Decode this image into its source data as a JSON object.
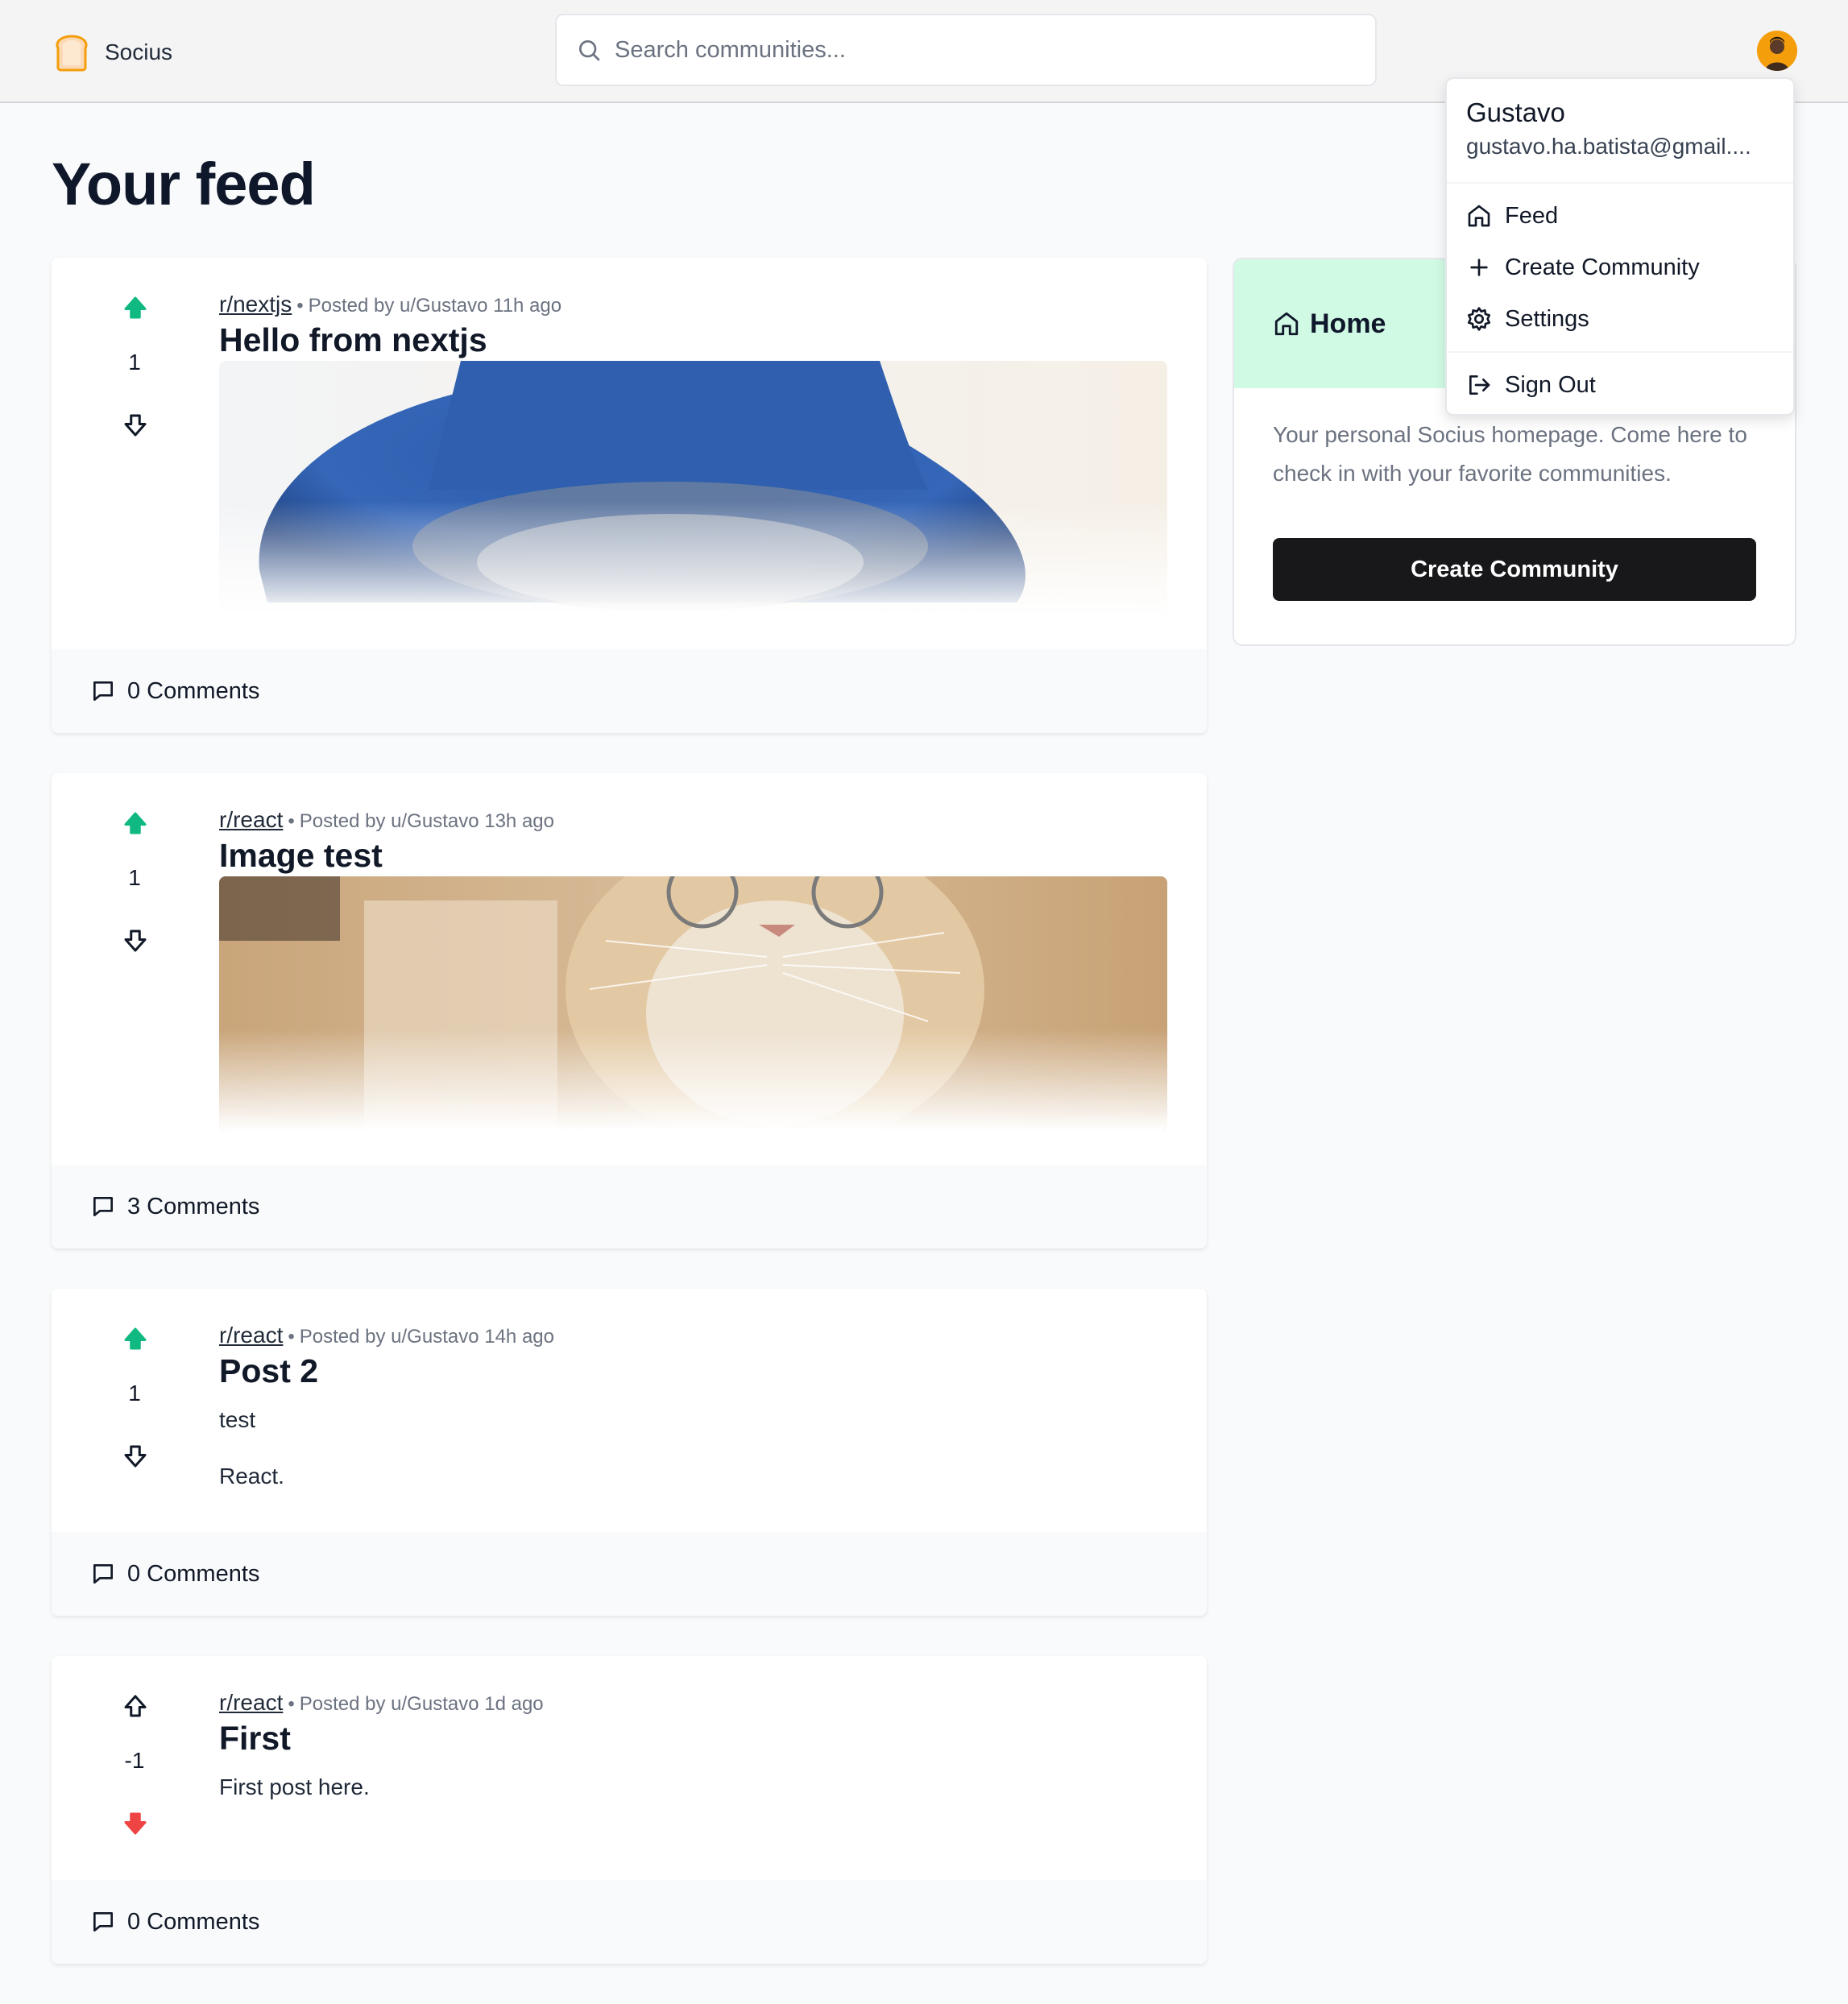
{
  "header": {
    "app_name": "Socius",
    "search_placeholder": "Search communities..."
  },
  "page_title": "Your feed",
  "posts": [
    {
      "subreddit": "r/nextjs",
      "meta": "Posted by u/Gustavo 11h ago",
      "title": "Hello from nextjs",
      "score": "1",
      "vote_state": "up",
      "has_image": true,
      "body": [],
      "comments": "0 Comments"
    },
    {
      "subreddit": "r/react",
      "meta": "Posted by u/Gustavo 13h ago",
      "title": "Image test",
      "score": "1",
      "vote_state": "up",
      "has_image": true,
      "body": [],
      "comments": "3 Comments"
    },
    {
      "subreddit": "r/react",
      "meta": "Posted by u/Gustavo 14h ago",
      "title": "Post 2",
      "score": "1",
      "vote_state": "up",
      "has_image": false,
      "body": [
        "test",
        "React."
      ],
      "comments": "0 Comments"
    },
    {
      "subreddit": "r/react",
      "meta": "Posted by u/Gustavo 1d ago",
      "title": "First",
      "score": "-1",
      "vote_state": "down",
      "has_image": false,
      "body": [
        "First post here."
      ],
      "comments": "0 Comments"
    }
  ],
  "sidebar": {
    "title": "Home",
    "description": "Your personal Socius homepage. Come here to check in with your favorite communities.",
    "button_label": "Create Community"
  },
  "user_menu": {
    "name": "Gustavo",
    "email": "gustavo.ha.batista@gmail....",
    "items": [
      {
        "label": "Feed",
        "icon": "home-icon"
      },
      {
        "label": "Create Community",
        "icon": "plus-icon"
      },
      {
        "label": "Settings",
        "icon": "gear-icon"
      },
      {
        "label": "Sign Out",
        "icon": "sign-out-icon"
      }
    ]
  },
  "colors": {
    "upvote_active": "#10b981",
    "downvote_active": "#ef4444",
    "sidebar_header": "#d1fae5",
    "button_dark": "#18181b"
  }
}
